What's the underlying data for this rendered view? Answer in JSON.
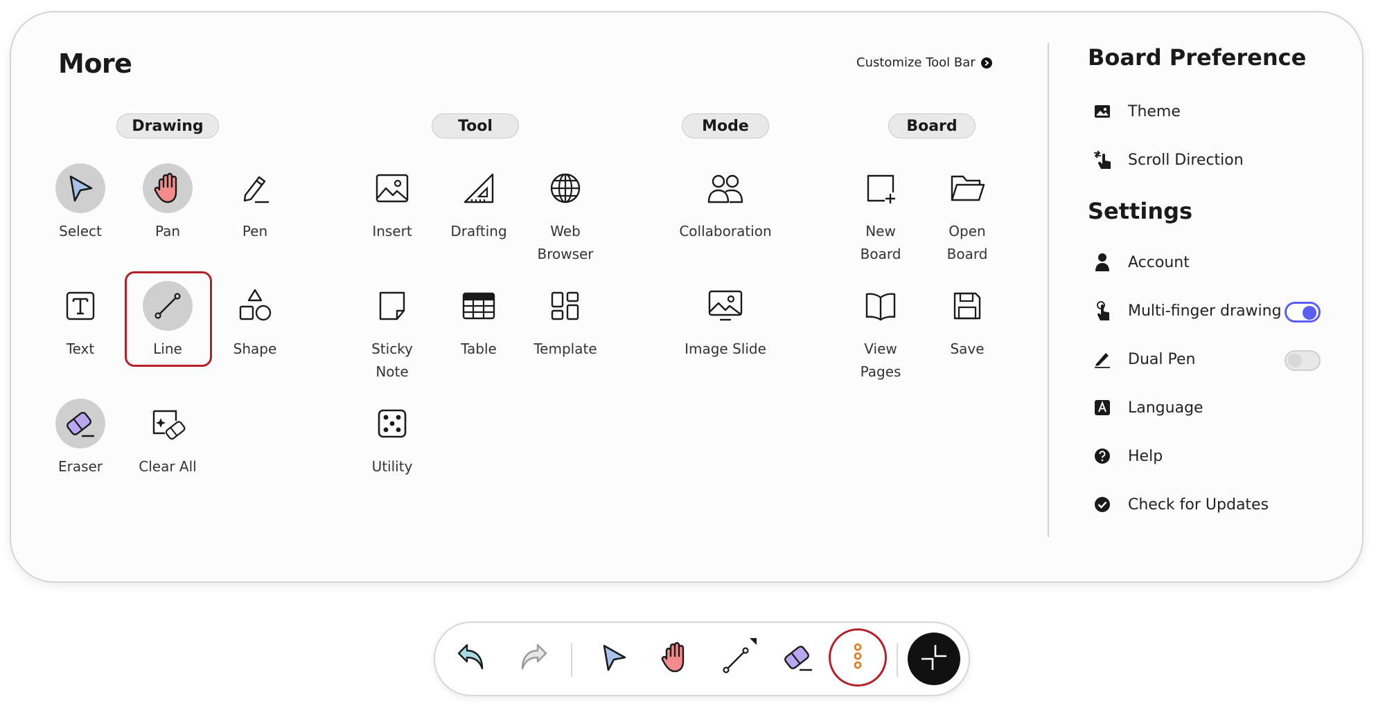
{
  "panel": {
    "title": "More",
    "customize_label": "Customize Tool Bar",
    "categories": {
      "drawing": "Drawing",
      "tool": "Tool",
      "mode": "Mode",
      "board": "Board"
    },
    "tools": {
      "select": {
        "label": "Select",
        "icon": "cursor-arrow-icon"
      },
      "pan": {
        "label": "Pan",
        "icon": "hand-icon"
      },
      "pen": {
        "label": "Pen",
        "icon": "pen-icon"
      },
      "text": {
        "label": "Text",
        "icon": "text-box-icon"
      },
      "line": {
        "label": "Line",
        "icon": "line-icon"
      },
      "shape": {
        "label": "Shape",
        "icon": "shapes-icon"
      },
      "eraser": {
        "label": "Eraser",
        "icon": "eraser-icon"
      },
      "clear_all": {
        "label": "Clear All",
        "icon": "clear-all-icon"
      },
      "insert": {
        "label": "Insert",
        "icon": "image-icon"
      },
      "drafting": {
        "label": "Drafting",
        "icon": "set-square-icon"
      },
      "web_browser": {
        "label": "Web\nBrowser",
        "icon": "globe-icon"
      },
      "sticky_note": {
        "label": "Sticky\nNote",
        "icon": "sticky-note-icon"
      },
      "table": {
        "label": "Table",
        "icon": "table-icon"
      },
      "template": {
        "label": "Template",
        "icon": "template-icon"
      },
      "utility": {
        "label": "Utility",
        "icon": "dice-icon"
      },
      "collaboration": {
        "label": "Collaboration",
        "icon": "people-icon"
      },
      "image_slide": {
        "label": "Image Slide",
        "icon": "image-slide-icon"
      },
      "new_board": {
        "label": "New\nBoard",
        "icon": "new-board-icon"
      },
      "open_board": {
        "label": "Open\nBoard",
        "icon": "folder-icon"
      },
      "view_pages": {
        "label": "View\nPages",
        "icon": "book-icon"
      },
      "save": {
        "label": "Save",
        "icon": "floppy-icon"
      }
    }
  },
  "sidebar": {
    "board_preference_title": "Board Preference",
    "theme": "Theme",
    "scroll_direction": "Scroll Direction",
    "settings_title": "Settings",
    "account": "Account",
    "multi_finger": "Multi-finger drawing",
    "multi_finger_on": true,
    "dual_pen": "Dual Pen",
    "dual_pen_on": false,
    "language": "Language",
    "help": "Help",
    "check_updates": "Check for Updates"
  },
  "toolbar": {
    "buttons": [
      "undo",
      "redo",
      "select",
      "pan",
      "line",
      "eraser",
      "more",
      "minimize"
    ]
  },
  "colors": {
    "accent": "#5a5ff2",
    "highlight_ring": "#b3202a",
    "active_bg": "#cfcfcf",
    "pan_hand": "#f28b8b",
    "cursor_fill": "#a9c3e8",
    "eraser_fill": "#b9a8f0",
    "more_dots": "#e07b1a"
  }
}
